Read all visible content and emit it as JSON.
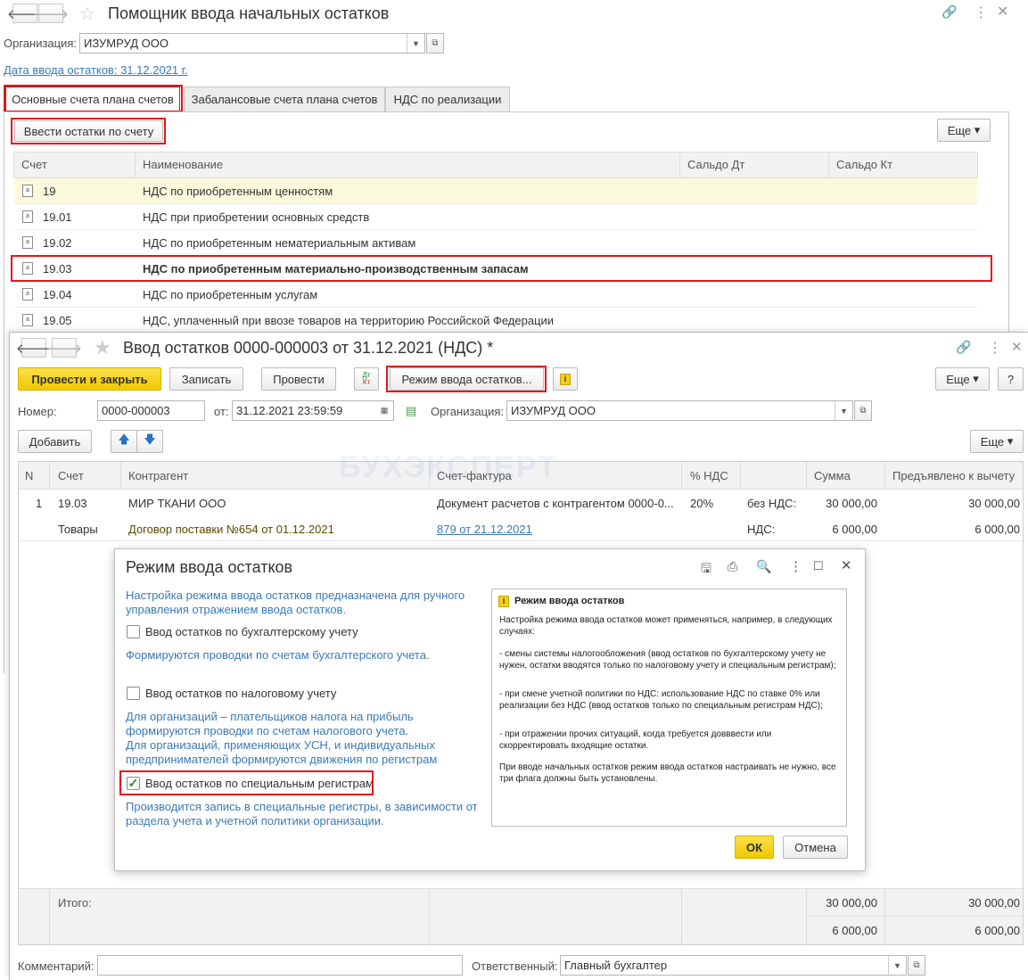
{
  "helper": {
    "title": "Помощник ввода начальных остатков",
    "org_label": "Организация:",
    "org_value": "ИЗУМРУД ООО",
    "date_link": "Дата ввода остатков: 31.12.2021 г.",
    "tabs": [
      "Основные счета плана счетов",
      "Забалансовые счета плана счетов",
      "НДС по реализации"
    ],
    "enter_button": "Ввести остатки по счету",
    "more_button": "Еще",
    "columns": [
      "Счет",
      "Наименование",
      "Сальдо Дт",
      "Сальдо Кт"
    ],
    "rows": [
      {
        "account": "19",
        "name": "НДС по приобретенным ценностям"
      },
      {
        "account": "19.01",
        "name": "НДС при приобретении основных средств"
      },
      {
        "account": "19.02",
        "name": "НДС по приобретенным нематериальным активам"
      },
      {
        "account": "19.03",
        "name": "НДС по приобретенным материально-производственным запасам"
      },
      {
        "account": "19.04",
        "name": "НДС по приобретенным услугам"
      },
      {
        "account": "19.05",
        "name": "НДС, уплаченный при ввозе товаров на территорию Российской Федерации"
      }
    ]
  },
  "doc": {
    "title": "Ввод остатков 0000-000003 от 31.12.2021 (НДС) *",
    "btn_post_close": "Провести и закрыть",
    "btn_save": "Записать",
    "btn_post": "Провести",
    "btn_dtkt_top": "Дт",
    "btn_dtkt_bottom": "Кт",
    "btn_mode": "Режим ввода остатков...",
    "btn_more": "Еще",
    "btn_help": "?",
    "number_label": "Номер:",
    "number_value": "0000-000003",
    "date_label": "от:",
    "date_value": "31.12.2021 23:59:59",
    "org_label": "Организация:",
    "org_value": "ИЗУМРУД ООО",
    "btn_add": "Добавить",
    "btn_more2": "Еще",
    "columns": [
      "N",
      "Счет",
      "Контрагент",
      "Счет-фактура",
      "% НДС",
      "Сумма",
      "Предъявлено к вычету"
    ],
    "line": {
      "n": "1",
      "account": "19.03",
      "contractor": "МИР ТКАНИ ООО",
      "invoice_doc": "Документ расчетов с контрагентом 0000-0...",
      "vat_rate": "20%",
      "no_vat_label": "без НДС:",
      "amount": "30 000,00",
      "deduct": "30 000,00",
      "account_sub": "Товары",
      "contract": "Договор поставки №654 от 01.12.2021",
      "invoice_link": "879 от 21.12.2021",
      "vat_label": "НДС:",
      "vat_amount": "6 000,00",
      "vat_deduct": "6 000,00"
    },
    "total_label": "Итого:",
    "total_amount": "30 000,00",
    "total_deduct": "30 000,00",
    "total_vat_amount": "6 000,00",
    "total_vat_deduct": "6 000,00",
    "comment_label": "Комментарий:",
    "responsible_label": "Ответственный:",
    "responsible_value": "Главный бухгалтер",
    "watermark": "БУХЭКСПЕРТ"
  },
  "dialog": {
    "title": "Режим ввода остатков",
    "intro": "Настройка режима ввода остатков предназначена для ручного управления отражением  ввода остатков.",
    "cb1_label": "Ввод остатков по бухгалтерскому учету",
    "cb1_note": "Формируются проводки по счетам бухгалтерского учета.",
    "cb2_label": "Ввод остатков по налоговому учету",
    "cb2_note1": "Для организаций – плательщиков налога на прибыль формируются проводки по счетам налогового учета.",
    "cb2_note2": "Для организаций, применяющих УСН, и  индивидуальных предпринимателей формируются движения по регистрам налог…",
    "cb3_label": "Ввод остатков по специальным регистрам",
    "cb3_checked": true,
    "cb3_note": "Производится запись в специальные регистры, в зависимости от раздела учета и учетной политики организации.",
    "help_title": "Режим ввода остатков",
    "help_p1": "Настройка режима ввода остатков может применяться, например, в следующих случаях:",
    "help_p2": "- смены системы налогообложения (ввод остатков по бухгалтерскому учету не нужен, остатки вводятся только по налоговому учету и специальным регистрам);",
    "help_p3": "- при смене учетной политики по НДС: использование НДС по ставке 0% или реализации без НДС (ввод остатков только по специальным регистрам НДС);",
    "help_p4": "- при отражении прочих ситуаций, когда требуется довввести или скорректировать входящие остатки.",
    "help_p5": "При вводе начальных остатков режим ввода остатков настраивать не нужно, все три флага должны быть установлены.",
    "ok": "ОК",
    "cancel": "Отмена"
  },
  "colors": {
    "accent_yellow": "#f5d21e",
    "red_highlight": "#e0161b",
    "link_blue": "#3a7ab8",
    "row_highlight": "#fbf9dc"
  }
}
